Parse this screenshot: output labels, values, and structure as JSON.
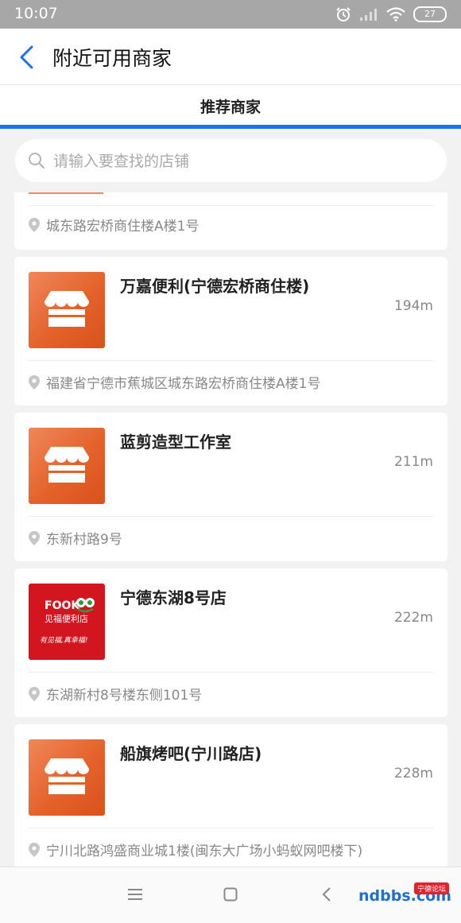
{
  "status_bar": {
    "time": "10:07",
    "battery": "27"
  },
  "header": {
    "title": "附近可用商家"
  },
  "tabs": [
    {
      "label": "推荐商家",
      "active": true
    }
  ],
  "search": {
    "placeholder": "请输入要查找的店铺",
    "value": ""
  },
  "partial_card": {
    "address": "城东路宏桥商住楼A楼1号"
  },
  "merchants": [
    {
      "name": "万嘉便利(宁德宏桥商住楼)",
      "distance": "194m",
      "address": "福建省宁德市蕉城区城东路宏桥商住楼A楼1号",
      "thumbnail": "store-icon"
    },
    {
      "name": "蓝剪造型工作室",
      "distance": "211m",
      "address": "东新村路9号",
      "thumbnail": "store-icon"
    },
    {
      "name": "宁德东湖8号店",
      "distance": "222m",
      "address": "东湖新村8号楼东侧101号",
      "thumbnail": "fook-logo",
      "logo": {
        "brand": "FOOK",
        "cn": "见福便利店",
        "slogan": "有见福,真幸福!"
      }
    },
    {
      "name": "船旗烤吧(宁川路店)",
      "distance": "228m",
      "address": "宁川北路鸿盛商业城1楼(闽东大广场小蚂蚁网吧楼下)",
      "thumbnail": "store-icon"
    }
  ],
  "watermark": {
    "text": "ndbbs.com",
    "badge": "宁德论坛"
  },
  "colors": {
    "accent": "#1a73e8",
    "thumb_orange": "#e4622a",
    "thumb_red": "#d2151e"
  }
}
